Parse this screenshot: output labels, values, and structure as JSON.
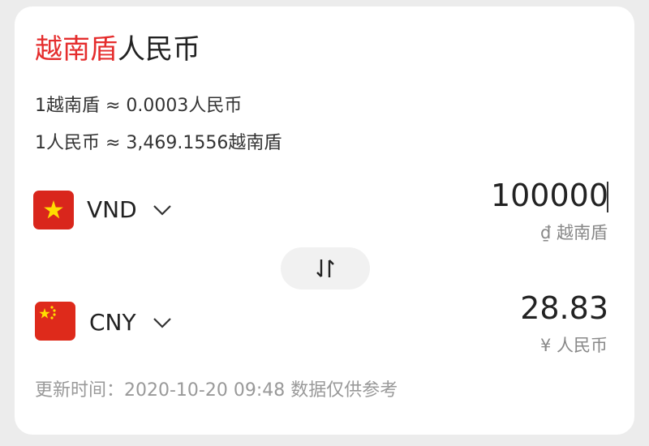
{
  "title": {
    "from": "越南盾",
    "to": "人民币"
  },
  "rates": {
    "line1": "1越南盾 ≈ 0.0003人民币",
    "line2": "1人民币 ≈ 3,469.1556越南盾"
  },
  "source": {
    "code": "VND",
    "amount": "100000",
    "unit": "₫ 越南盾",
    "flag_icon": "vietnam-flag-icon"
  },
  "target": {
    "code": "CNY",
    "amount": "28.83",
    "unit": "¥ 人民币",
    "flag_icon": "china-flag-icon"
  },
  "swap_icon": "swap-arrows-icon",
  "footer": "更新时间：2020-10-20 09:48 数据仅供参考",
  "colors": {
    "accent": "#e52d2d",
    "vn_flag": "#d9261c",
    "cn_flag": "#de2a1b",
    "star": "#ffde00",
    "muted": "#999999"
  }
}
